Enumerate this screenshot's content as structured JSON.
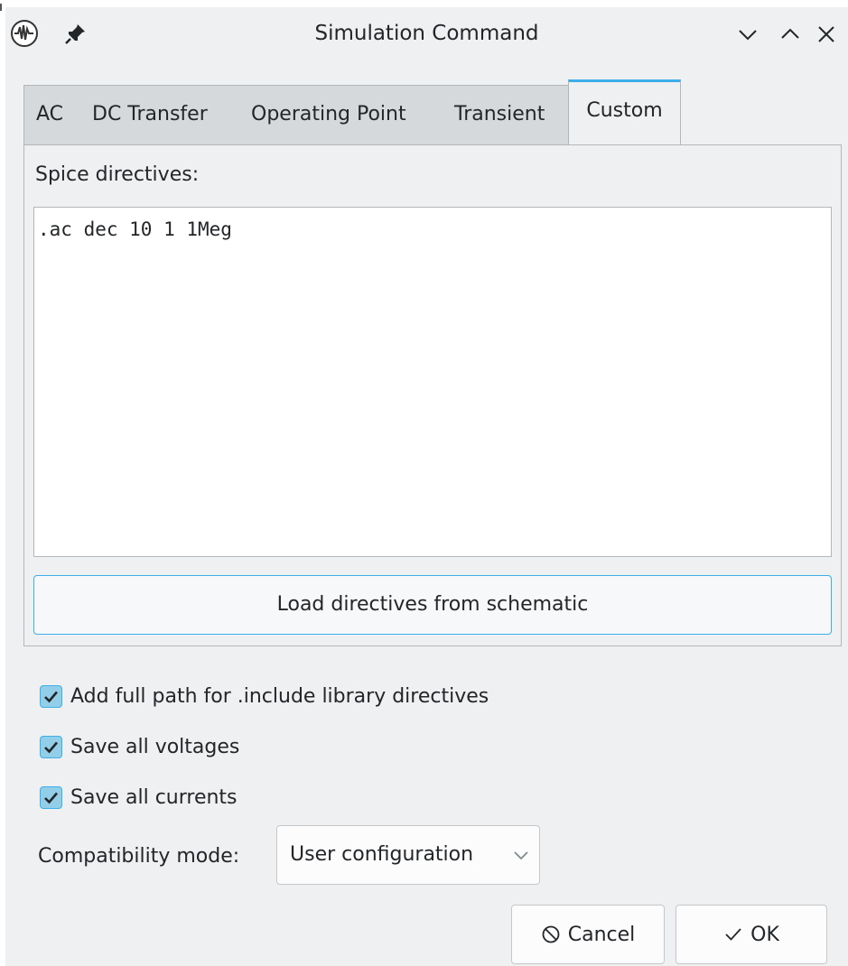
{
  "window": {
    "title": "Simulation Command"
  },
  "tabs": [
    {
      "label": "AC",
      "active": false
    },
    {
      "label": "DC Transfer",
      "active": false
    },
    {
      "label": "Operating Point",
      "active": false
    },
    {
      "label": "Transient",
      "active": false
    },
    {
      "label": "Custom",
      "active": true
    }
  ],
  "custom": {
    "directives_label": "Spice directives:",
    "directives_value": ".ac dec 10 1 1Meg",
    "load_button": "Load directives from schematic"
  },
  "options": [
    {
      "label": "Add full path for .include library directives",
      "checked": true
    },
    {
      "label": "Save all voltages",
      "checked": true
    },
    {
      "label": "Save all currents",
      "checked": true
    }
  ],
  "compatibility": {
    "label": "Compatibility mode:",
    "value": "User configuration"
  },
  "buttons": {
    "cancel": "Cancel",
    "ok": "OK"
  },
  "colors": {
    "accent": "#3daee9",
    "check_fill": "#93cee9",
    "window_bg": "#eff0f1"
  },
  "icons": [
    "app-waveform-icon",
    "pin-icon",
    "minimize-icon",
    "maximize-icon",
    "close-icon",
    "chevron-down-icon",
    "cancel-icon",
    "checkmark-icon"
  ]
}
